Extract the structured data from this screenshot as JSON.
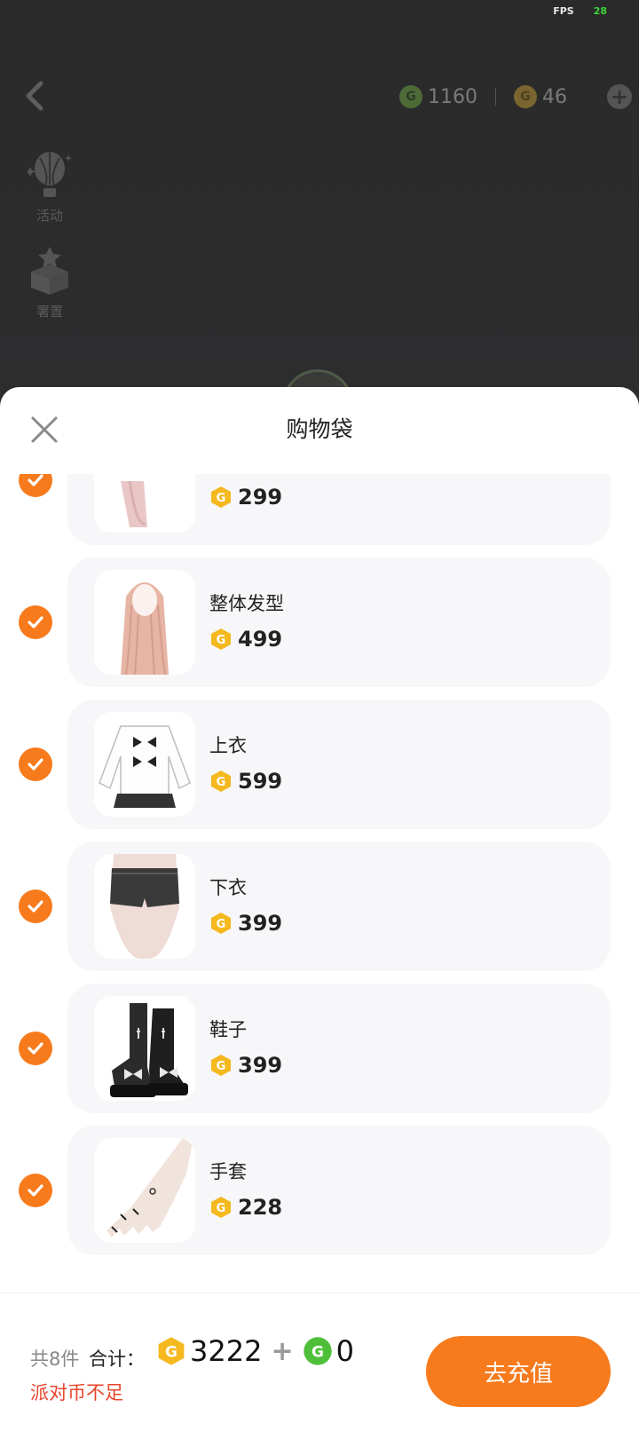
{
  "status": {
    "fps_label": "FPS",
    "fps_value": "28"
  },
  "topbar": {
    "green_currency": "1160",
    "gold_currency": "46"
  },
  "side_menu": [
    {
      "label": "活动"
    },
    {
      "label": "署置"
    }
  ],
  "sheet": {
    "title": "购物袋",
    "items": [
      {
        "name": "",
        "price": "299",
        "checked": true
      },
      {
        "name": "整体发型",
        "price": "499",
        "checked": true
      },
      {
        "name": "上衣",
        "price": "599",
        "checked": true
      },
      {
        "name": "下衣",
        "price": "399",
        "checked": true
      },
      {
        "name": "鞋子",
        "price": "399",
        "checked": true
      },
      {
        "name": "手套",
        "price": "228",
        "checked": true
      }
    ]
  },
  "footer": {
    "count": "共8件",
    "total_label": "合计：",
    "gold_total": "3222",
    "plus": "+",
    "green_total": "0",
    "warning": "派对币不足",
    "button": "去充值"
  },
  "colors": {
    "accent": "#f77a1c",
    "warning": "#e8452c",
    "gold_coin": "#f5b81e",
    "green_coin": "#4fbf3a"
  }
}
